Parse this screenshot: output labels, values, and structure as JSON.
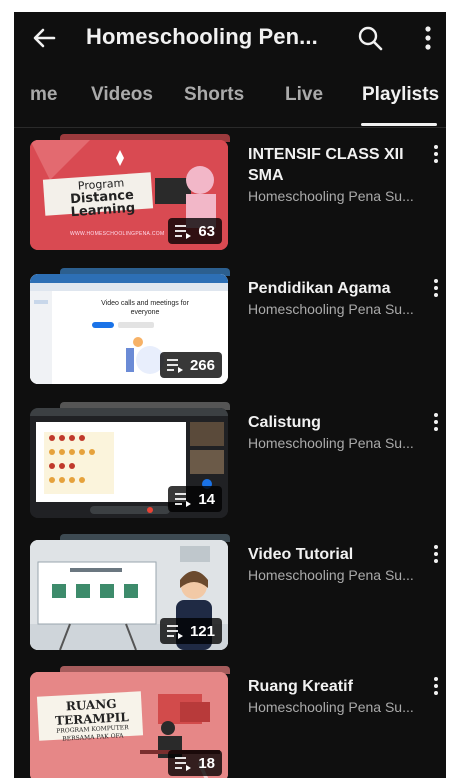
{
  "header": {
    "title": "Homeschooling Pen...",
    "back_icon": "arrow-left-icon",
    "search_icon": "search-icon",
    "more_icon": "more-vert-icon"
  },
  "tabs": [
    {
      "label": "me",
      "active": false
    },
    {
      "label": "Videos",
      "active": false
    },
    {
      "label": "Shorts",
      "active": false
    },
    {
      "label": "Live",
      "active": false
    },
    {
      "label": "Playlists",
      "active": true
    }
  ],
  "playlists": [
    {
      "title": "INTENSIF CLASS XII SMA",
      "channel": "Homeschooling Pena Su...",
      "count": "63",
      "thumb_text": [
        "Program",
        "Distance Learning"
      ],
      "thumb_footer": "WWW.HOMESCHOOLINGPENA.COM"
    },
    {
      "title": "Pendidikan Agama",
      "channel": "Homeschooling Pena Su...",
      "count": "266",
      "thumb_text": [
        "Video calls and meetings for",
        "everyone"
      ]
    },
    {
      "title": "Calistung",
      "channel": "Homeschooling Pena Su...",
      "count": "14"
    },
    {
      "title": "Video Tutorial",
      "channel": "Homeschooling Pena Su...",
      "count": "121"
    },
    {
      "title": "Ruang Kreatif",
      "channel": "Homeschooling Pena Su...",
      "count": "18",
      "thumb_text": [
        "RUANG TERAMPIL",
        "PROGRAM KOMPUTER",
        "BERSAMA PAK OFA"
      ]
    }
  ],
  "colors": {
    "background": "#0f0f0f",
    "text_primary": "#f1f1f1",
    "text_secondary": "#aaaaaa"
  }
}
